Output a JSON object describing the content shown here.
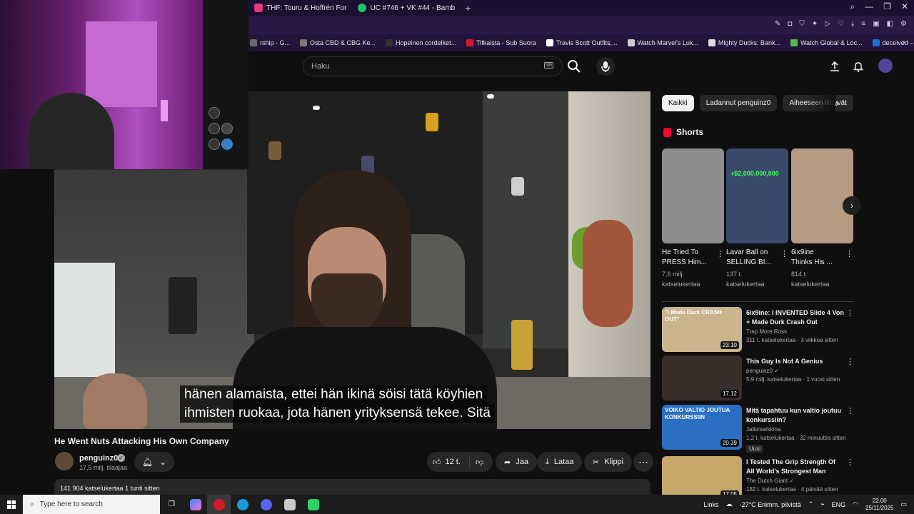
{
  "browser": {
    "tabs": [
      {
        "label": "THF: Touru & Hoffrén For",
        "color": "#e63b7a"
      },
      {
        "label": "UC #746 + VK #44 - Bamb",
        "color": "#25c06b"
      }
    ],
    "new_tab": "+",
    "window_controls": [
      "⌕",
      "—",
      "❐",
      "✕"
    ],
    "bookmarks": [
      {
        "label": "rship - G...",
        "color": "#6a6a6a"
      },
      {
        "label": "Osta CBD & CBG Ke...",
        "color": "#7a7a7a"
      },
      {
        "label": "Hopeinen cordelket...",
        "color": "#333333"
      },
      {
        "label": "Tifkaista - Sub Suora",
        "color": "#d21c2b"
      },
      {
        "label": "Travis Scott Outfits,...",
        "color": "#ffffff"
      },
      {
        "label": "Watch Marvel's Luk...",
        "color": "#cccccc"
      },
      {
        "label": "Mighty Ducks: Bank...",
        "color": "#dddddd"
      },
      {
        "label": "Watch Global & Loc...",
        "color": "#55b947"
      },
      {
        "label": "deceived – SUORAT...",
        "color": "#1f6fd1"
      }
    ]
  },
  "header": {
    "search_placeholder": "Haku"
  },
  "video": {
    "caption_line1": "hänen alamaista, ettei hän ikinä söisi tätä köyhien",
    "caption_line2": "ihmisten ruokaa, jota hänen yrityksensä tekee.  Sitä",
    "title": "He Went Nuts Attacking His Own Company",
    "channel": "penguinz0",
    "subscribers": "17,5 milj. tilaajaa",
    "likes": "12 t.",
    "share_label": "Jaa",
    "download_label": "Lataa",
    "clip_label": "Klippi",
    "views_time": "141 904 katselukertaa  1 tunti sitten"
  },
  "chips": [
    {
      "label": "Kaikki",
      "active": true
    },
    {
      "label": "Ladannut penguinz0",
      "active": false
    },
    {
      "label": "Aiheeseen liittyvät",
      "active": false
    }
  ],
  "shorts": {
    "heading": "Shorts",
    "items": [
      {
        "title": "He Tried To\nPRESS Him...",
        "views": "7,6 milj.\nkatselukertaa",
        "thumb": "#8c8c8c"
      },
      {
        "title": "Lavar Ball on\nSELLING BI...",
        "views": "137 t.\nkatselukertaa",
        "thumb": "#3a4a6a",
        "overlay": "+$2,000,000,000"
      },
      {
        "title": "6ix9ine\nThinks His ...",
        "views": "814 t.\nkatselukertaa",
        "thumb": "#b59a84"
      }
    ]
  },
  "recommendations": [
    {
      "title": "6ix9ine: I INVENTED Slide 4 Von\n+ Made Durk Crash Out",
      "channel": "Trap More Ross",
      "meta": "211 t. katselukertaa · 3 viikkoa sitten",
      "duration": "23.10",
      "thumb": "#c9b48c",
      "thumb_text": "\"I Made Durk CRASH OUT\"",
      "verified": false
    },
    {
      "title": "This Guy Is Not A Genius",
      "channel": "penguinz0",
      "meta": "5,9 milj. katselukertaa · 1 vuosi sitten",
      "duration": "17.12",
      "thumb": "#3a2e2a",
      "verified": true
    },
    {
      "title": "Mitä tapahtuu kun valtio joutuu\nkonkurssiin?",
      "channel": "Jalkimarkkina",
      "meta": "1,2 t. katselukertaa · 32 minuuttia sitten",
      "duration": "20.39",
      "thumb": "#2b6fc4",
      "thumb_text": "VOIKO VALTIO JOUTUA KONKURSSIIN",
      "badge": "Uusi",
      "verified": false
    },
    {
      "title": "I Tested The Grip Strength Of\nAll World's Strongest Man",
      "channel": "The Dutch Giant",
      "meta": "182 t. katselukertaa · 4 päivää sitten",
      "duration": "17.05",
      "thumb": "#c8a86a",
      "verified": true
    }
  ],
  "taskbar": {
    "search_placeholder": "Type here to search",
    "links": "Links",
    "weather": "-27°C  Enimm. pilvistä",
    "lang": "ENG",
    "time": "22.00",
    "date": "25/11/2025"
  }
}
